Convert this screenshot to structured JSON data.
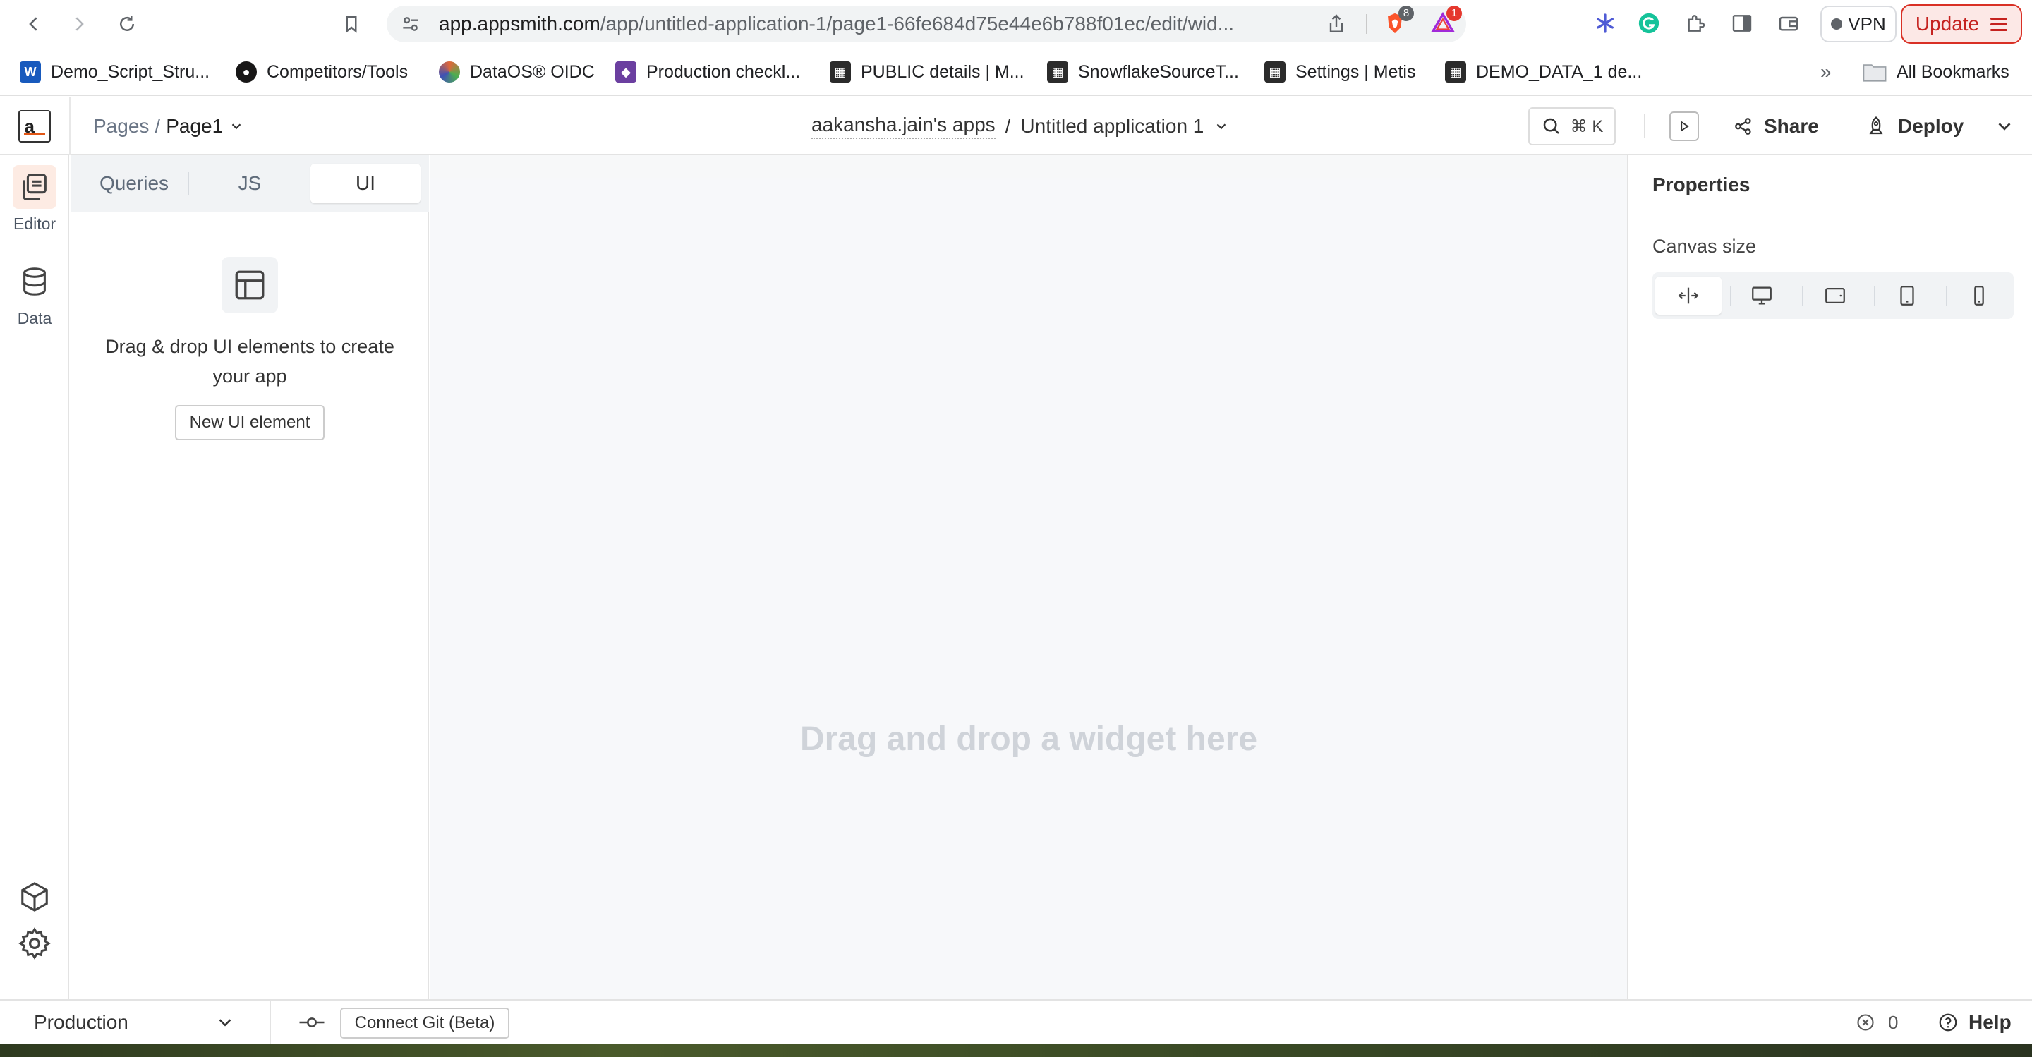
{
  "browser": {
    "url_host": "app.appsmith.com",
    "url_path": "/app/untitled-application-1/page1-66fe684d75e44e6b788f01ec/edit/wid...",
    "brave_badge": "8",
    "rewards_badge": "1",
    "vpn_label": "VPN",
    "update_label": "Update"
  },
  "bookmarks": {
    "items": [
      {
        "label": "Demo_Script_Stru...",
        "icon": "word-icon",
        "color": "#185abd"
      },
      {
        "label": "Competitors/Tools",
        "icon": "github-icon",
        "color": "#181717"
      },
      {
        "label": "DataOS® OIDC",
        "icon": "dataos-icon",
        "color": "#e0673a"
      },
      {
        "label": "Production checkl...",
        "icon": "layers-icon",
        "color": "#6b3fa0"
      },
      {
        "label": "PUBLIC details | M...",
        "icon": "metis-icon",
        "color": "#2b2b2b"
      },
      {
        "label": "SnowflakeSourceT...",
        "icon": "metis-icon",
        "color": "#2b2b2b"
      },
      {
        "label": "Settings | Metis",
        "icon": "metis-icon",
        "color": "#2b2b2b"
      },
      {
        "label": "DEMO_DATA_1 de...",
        "icon": "metis-icon",
        "color": "#2b2b2b"
      }
    ],
    "more": "»",
    "all_label": "All Bookmarks"
  },
  "header": {
    "logo_text": "a_",
    "pages_label": "Pages",
    "separator": "/",
    "page_name": "Page1",
    "workspace": "aakansha.jain's apps",
    "app_name": "Untitled application 1",
    "search_shortcut": "⌘ K",
    "share_label": "Share",
    "deploy_label": "Deploy",
    "accent": "#e15615"
  },
  "iconbar": {
    "editor_label": "Editor",
    "data_label": "Data"
  },
  "explorer": {
    "tabs": [
      {
        "label": "Queries"
      },
      {
        "label": "JS"
      },
      {
        "label": "UI"
      }
    ],
    "active_tab": "UI",
    "empty_text": "Drag & drop UI elements to create your app",
    "new_ui_button": "New UI element"
  },
  "canvas": {
    "hint": "Drag and drop a widget here"
  },
  "properties": {
    "title": "Properties",
    "canvas_size_label": "Canvas size",
    "size_options": [
      "fluid-icon",
      "desktop-icon",
      "tablet-landscape-icon",
      "tablet-icon",
      "mobile-icon"
    ]
  },
  "bottombar": {
    "environment": "Production",
    "git_button": "Connect Git (Beta)",
    "error_count": "0",
    "help_label": "Help"
  }
}
